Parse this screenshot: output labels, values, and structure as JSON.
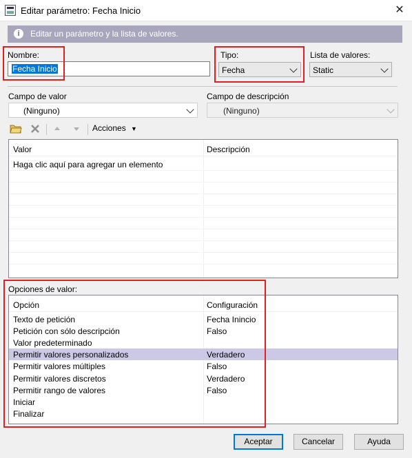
{
  "window": {
    "title": "Editar parámetro: Fecha Inicio",
    "close_glyph": "✕"
  },
  "info": {
    "text": "Editar un parámetro y la lista de valores."
  },
  "form": {
    "nombre_label": "Nombre:",
    "nombre_value": "Fecha Inicio",
    "tipo_label": "Tipo:",
    "tipo_value": "Fecha",
    "lista_label": "Lista de valores:",
    "lista_value": "Static",
    "campo_valor_label": "Campo de valor",
    "campo_valor_value": "(Ninguno)",
    "campo_desc_label": "Campo de descripción",
    "campo_desc_value": "(Ninguno)"
  },
  "toolbar": {
    "acciones_label": "Acciones",
    "acciones_arrow": "▼"
  },
  "values_grid": {
    "headers": [
      "Valor",
      "Descripción"
    ],
    "placeholder_row": "Haga clic aquí para agregar un elemento"
  },
  "options": {
    "section_label": "Opciones de valor:",
    "headers": [
      "Opción",
      "Configuración"
    ],
    "rows": [
      {
        "option": "Texto de petición",
        "config": "Fecha Inincio"
      },
      {
        "option": "Petición con sólo descripción",
        "config": "Falso"
      },
      {
        "option": "Valor predeterminado",
        "config": ""
      },
      {
        "option": "Permitir valores personalizados",
        "config": "Verdadero"
      },
      {
        "option": "Permitir valores múltiples",
        "config": "Falso"
      },
      {
        "option": "Permitir valores discretos",
        "config": "Verdadero"
      },
      {
        "option": "Permitir rango de valores",
        "config": "Falso"
      },
      {
        "option": "Iniciar",
        "config": ""
      },
      {
        "option": "Finalizar",
        "config": ""
      }
    ],
    "selected_index": 3
  },
  "buttons": {
    "aceptar": "Aceptar",
    "cancelar": "Cancelar",
    "ayuda": "Ayuda"
  },
  "colors": {
    "highlight_red": "#e02020",
    "selected_row": "#ccc9e6",
    "info_bar": "#a8a6bd",
    "default_button_border": "#0078d7"
  }
}
